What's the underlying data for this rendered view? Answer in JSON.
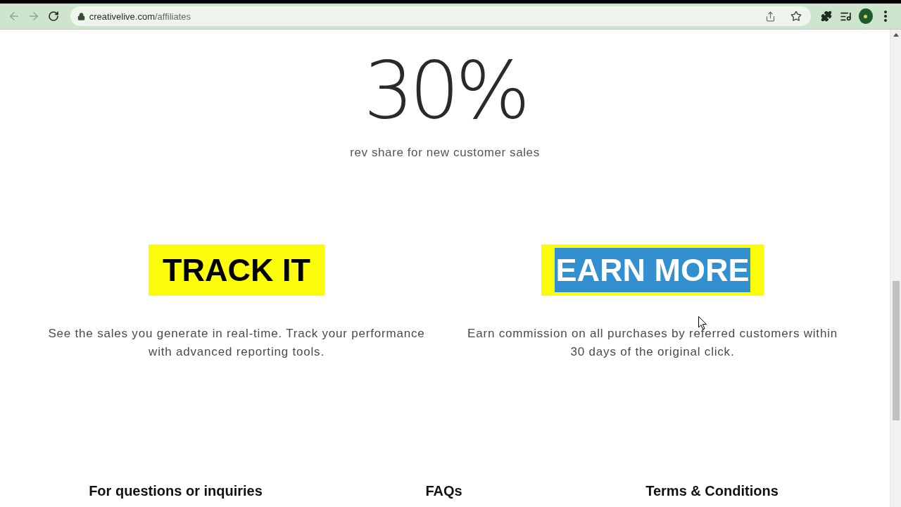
{
  "browser": {
    "back_button": {
      "disabled": true
    },
    "forward_button": {
      "disabled": true
    },
    "address": {
      "domain": "creativelive.com",
      "path": "/affiliates"
    }
  },
  "stat": {
    "value": "30%",
    "caption": "rev share for new customer sales"
  },
  "features": [
    {
      "heading": "TRACK IT",
      "text_selected": false,
      "description": "See the sales you generate in real-time. Track your performance with advanced reporting tools."
    },
    {
      "heading": "EARN MORE",
      "text_selected": true,
      "description": "Earn commission on all purchases by referred customers within 30 days of the original click."
    }
  ],
  "footer": {
    "columns": [
      {
        "heading": "For questions or inquiries"
      },
      {
        "heading": "FAQs"
      },
      {
        "heading": "Terms & Conditions"
      }
    ]
  }
}
